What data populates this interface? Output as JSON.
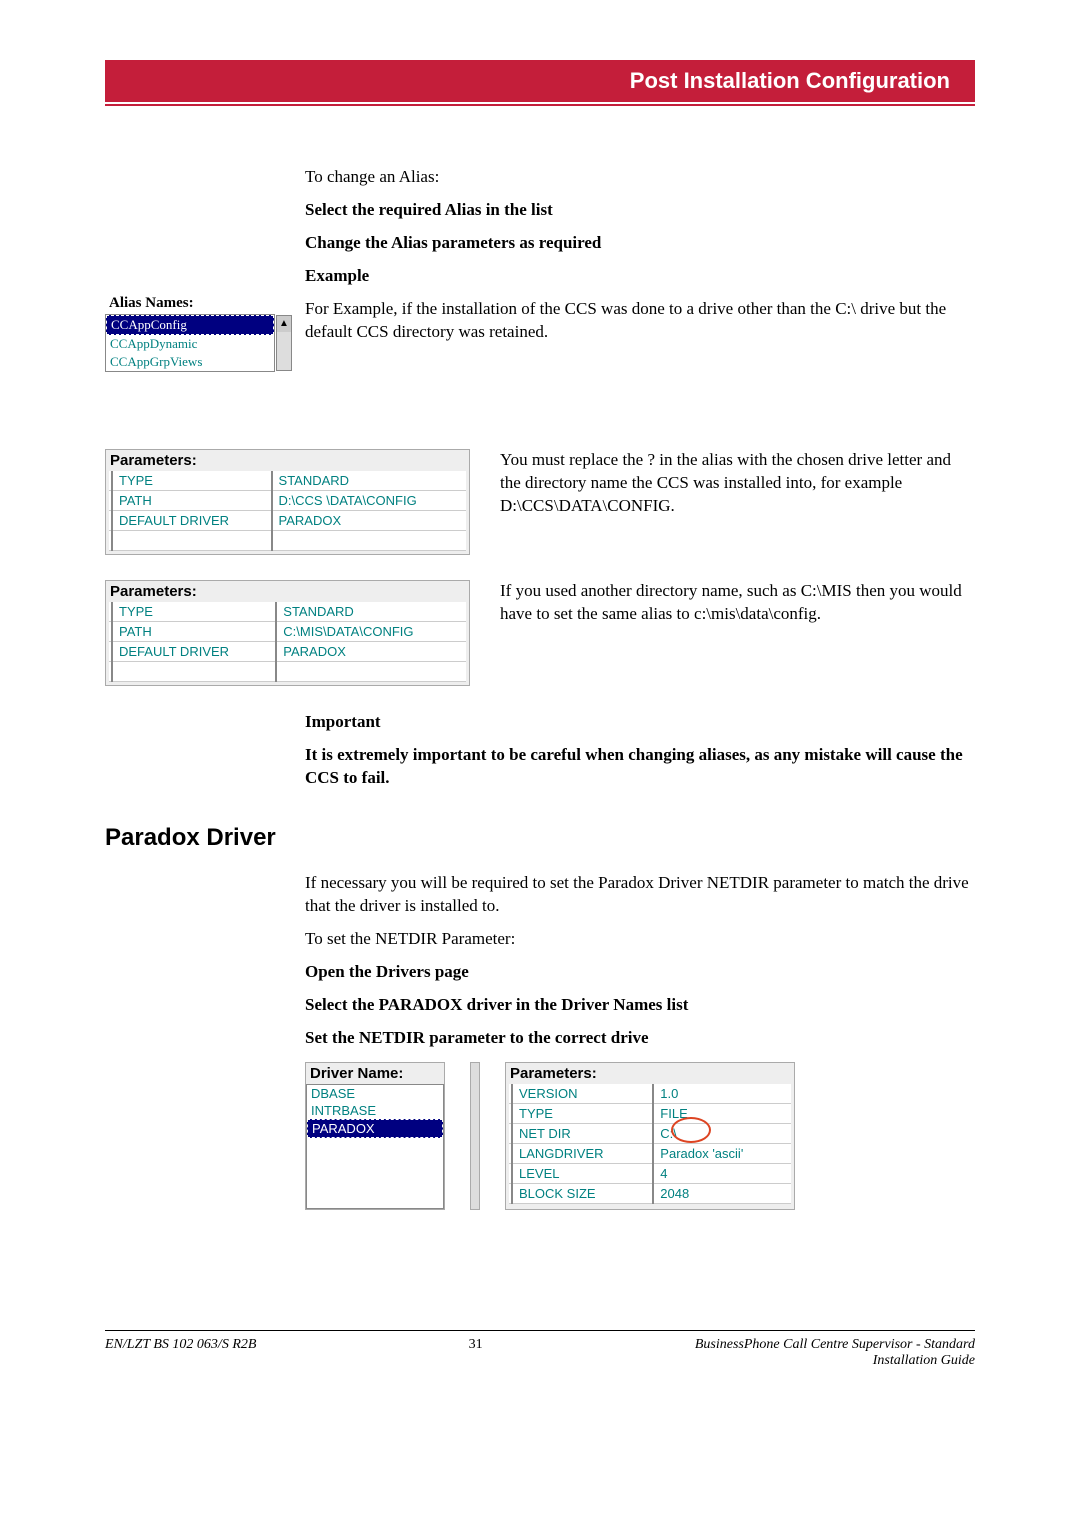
{
  "header": {
    "banner_title": "Post Installation Configuration"
  },
  "body": {
    "intro": "To change an Alias:",
    "step1": "Select the required Alias in the list",
    "step2": "Change the Alias parameters as required",
    "example_label": "Example",
    "example_text": "For Example, if the installation of the CCS was done to a drive other than the C:\\ drive but the default CCS directory was retained.",
    "param1_side": "You must replace the ? in the alias with the chosen drive letter and the directory name the CCS was installed into, for example D:\\CCS\\DATA\\CONFIG.",
    "param2_side": "If you used another directory name, such as C:\\MIS then you would have to set the same alias to c:\\mis\\data\\config.",
    "important_label": "Important",
    "important_text": "It is extremely important to be careful when changing aliases, as any mistake will cause the CCS to fail.",
    "paradox_heading": "Paradox Driver",
    "paradox_intro": "If necessary you will be required to set the Paradox Driver NETDIR parameter to match the drive that the driver is installed to.",
    "paradox_step0": "To set the NETDIR Parameter:",
    "paradox_step1": "Open the Drivers page",
    "paradox_step2": "Select the PARADOX driver in the Driver Names list",
    "paradox_step3": "Set the NETDIR parameter to the correct drive"
  },
  "alias_box": {
    "title": "Alias Names:",
    "items": [
      "CCAppConfig",
      "CCAppDynamic",
      "CCAppGrpViews"
    ]
  },
  "param_box1": {
    "title": "Parameters:",
    "rows": [
      [
        "TYPE",
        "STANDARD"
      ],
      [
        "PATH",
        "D:\\CCS \\DATA\\CONFIG"
      ],
      [
        "DEFAULT DRIVER",
        "PARADOX"
      ]
    ]
  },
  "param_box2": {
    "title": "Parameters:",
    "rows": [
      [
        "TYPE",
        "STANDARD"
      ],
      [
        "PATH",
        "C:\\MIS\\DATA\\CONFIG"
      ],
      [
        "DEFAULT DRIVER",
        "PARADOX"
      ]
    ]
  },
  "driver_name": {
    "title": "Driver Name:",
    "items": [
      "DBASE",
      "INTRBASE",
      "PARADOX"
    ]
  },
  "driver_params": {
    "title": "Parameters:",
    "rows": [
      [
        "VERSION",
        "1.0"
      ],
      [
        "TYPE",
        "FILE"
      ],
      [
        "NET DIR",
        "C:\\"
      ],
      [
        "LANGDRIVER",
        "Paradox 'ascii'"
      ],
      [
        "LEVEL",
        "4"
      ],
      [
        "BLOCK SIZE",
        "2048"
      ]
    ]
  },
  "footer": {
    "left": "EN/LZT BS 102 063/S R2B",
    "page": "31",
    "right1": "BusinessPhone Call Centre Supervisor - Standard",
    "right2": "Installation Guide"
  }
}
